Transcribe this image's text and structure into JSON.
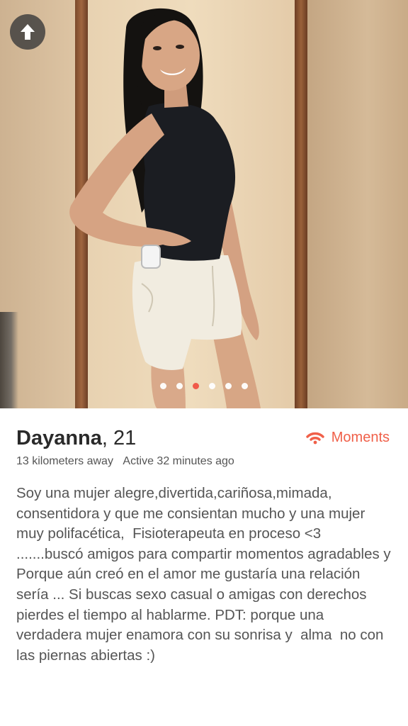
{
  "profile": {
    "name": "Dayanna",
    "age": ", 21",
    "distance": "13 kilometers away",
    "active": "Active 32 minutes ago",
    "bio": "Soy una mujer alegre,divertida,cariñosa,mimada, consentidora y que me consientan mucho y una mujer muy polifacética,  Fisioterapeuta en proceso <3  .......buscó amigos para compartir momentos agradables y Porque aún creó en el amor me gustaría una relación sería ... Si buscas sexo casual o amigas con derechos pierdes el tiempo al hablarme. PDT: porque una verdadera mujer enamora con su sonrisa y  alma  no con las piernas abiertas :)"
  },
  "moments": {
    "label": "Moments",
    "icon": "wifi-signal-icon",
    "color": "#f06049"
  },
  "photo": {
    "total": 6,
    "current": 3,
    "up_icon": "arrow-up-icon",
    "active_dot_color": "#f05a4a"
  }
}
